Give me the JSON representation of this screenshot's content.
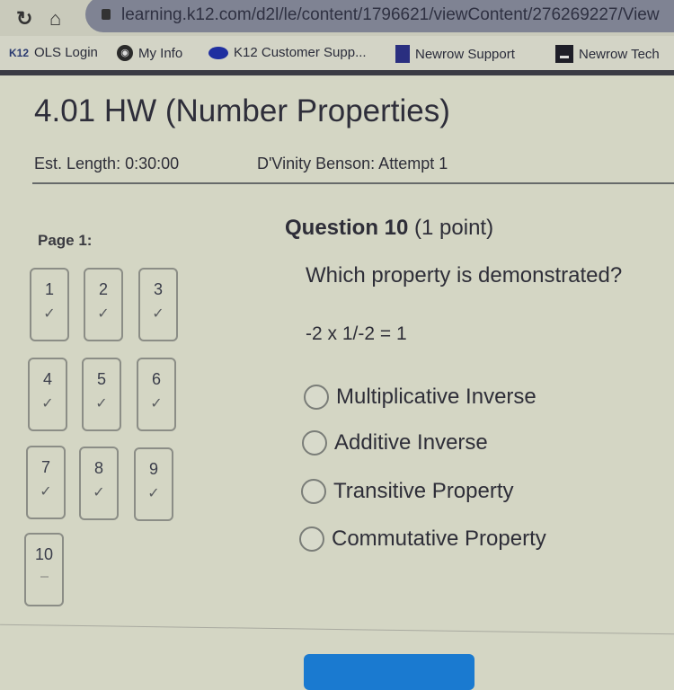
{
  "browser": {
    "url": "learning.k12.com/d2l/le/content/1796621/viewContent/276269227/View",
    "nav": {
      "reload_icon": "reload-icon",
      "home_icon": "home-icon",
      "lock_icon": "lock-icon"
    },
    "bookmarks": [
      {
        "label": "OLS Login",
        "icon": "k12-logo-icon",
        "icon_text": "K12"
      },
      {
        "label": "My Info",
        "icon": "globe-icon"
      },
      {
        "label": "K12 Customer Supp...",
        "icon": "salesforce-cloud-icon"
      },
      {
        "label": "Newrow Support",
        "icon": "newrow-icon"
      },
      {
        "label": "Newrow Tech",
        "icon": "newrow-tech-icon"
      }
    ]
  },
  "header": {
    "title": "4.01 HW (Number Properties)",
    "est_length": "Est. Length: 0:30:00",
    "attempt": "D'Vinity Benson: Attempt 1"
  },
  "pages": {
    "label": "Page 1:",
    "questions": [
      {
        "number": "1",
        "status": "✓",
        "answered": true
      },
      {
        "number": "2",
        "status": "✓",
        "answered": true
      },
      {
        "number": "3",
        "status": "✓",
        "answered": true
      },
      {
        "number": "4",
        "status": "✓",
        "answered": true
      },
      {
        "number": "5",
        "status": "✓",
        "answered": true
      },
      {
        "number": "6",
        "status": "✓",
        "answered": true
      },
      {
        "number": "7",
        "status": "✓",
        "answered": true
      },
      {
        "number": "8",
        "status": "✓",
        "answered": true
      },
      {
        "number": "9",
        "status": "✓",
        "answered": true
      },
      {
        "number": "10",
        "status": "---",
        "answered": false
      }
    ]
  },
  "question": {
    "heading": "Question 10",
    "points": "(1 point)",
    "prompt": "Which property is demonstrated?",
    "expression": "-2 x 1/-2 = 1",
    "options": [
      {
        "label": "Multiplicative Inverse",
        "selected": false
      },
      {
        "label": "Additive Inverse",
        "selected": false
      },
      {
        "label": "Transitive Property",
        "selected": false
      },
      {
        "label": "Commutative Property",
        "selected": false
      }
    ]
  },
  "colors": {
    "accent": "#1a7ad0",
    "background": "#d4d6c4"
  }
}
